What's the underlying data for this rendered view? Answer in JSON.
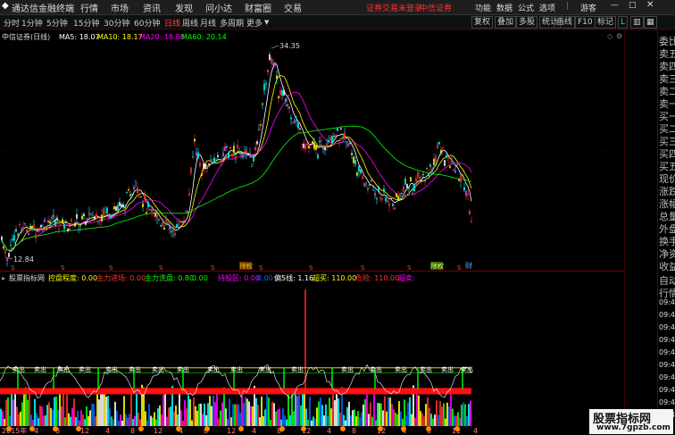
{
  "app": {
    "title": "通达信金融终端",
    "menu": [
      "行情",
      "市场",
      "资讯",
      "发现",
      "问小达",
      "财富圈",
      "交易"
    ],
    "notice": "证券交易未登录",
    "broker": "中信证券",
    "right_menu": [
      "功能",
      "数据",
      "公式",
      "选项"
    ],
    "user": "游客"
  },
  "toolbar": {
    "periods": [
      "分时",
      "1分钟",
      "5分钟",
      "15分钟",
      "30分钟",
      "60分钟",
      "日线",
      "周线",
      "月线",
      "多周期",
      "更多"
    ],
    "active_period": "日线",
    "right_buttons": [
      "复权",
      "叠加",
      "多股",
      "统计",
      "画线",
      "F10",
      "标记"
    ]
  },
  "main": {
    "stock_label": "中信证券(日线)",
    "ma": [
      {
        "label": "MA5: 18.07",
        "color": "#ffffff"
      },
      {
        "label": "MA10: 18.17",
        "color": "#ffff00"
      },
      {
        "label": "MA20: 18.80",
        "color": "#ff00ff"
      },
      {
        "label": "MA60: 20.14",
        "color": "#00ff00"
      }
    ],
    "high_label": "34.35",
    "low_label": "12.84",
    "y_ticks": [
      "34.00",
      "32.00",
      "30.00",
      "28.00",
      "26.00",
      "24.00",
      "22.00",
      "20.00",
      "18.00",
      "16.00",
      "14.00"
    ],
    "ylim": [
      13,
      35
    ],
    "events": [
      "除权",
      "除权",
      "财"
    ]
  },
  "indicator": {
    "name": "股票指标网",
    "items": [
      {
        "label": "控盘程度: 0.00",
        "color": "#ffff00"
      },
      {
        "label": "主力进场: 0.00",
        "color": "#ff3333"
      },
      {
        "label": "主力洗盘: 0.80",
        "color": "#00ff00"
      },
      {
        "label": "0.00",
        "color": "#00ff00"
      },
      {
        "label": "持股区: 0.00",
        "color": "#ff00ff"
      },
      {
        "label": "0.00",
        "color": "#0066ff"
      },
      {
        "label": "偏5线: 1.16",
        "color": "#ffffff"
      },
      {
        "label": "超买: 110.00",
        "color": "#ffff00"
      },
      {
        "label": "危险: 110.00",
        "color": "#ff3333"
      },
      {
        "label": "超卖: ",
        "color": "#ff00ff"
      }
    ],
    "y_ticks": [
      "250.00",
      "200.00",
      "150.00",
      "100.00",
      "50.00",
      "0.00"
    ],
    "ylim": [
      0,
      270
    ],
    "sell_label": "卖出"
  },
  "right_panel": {
    "labels": [
      "委比",
      "卖五",
      "卖四",
      "卖三",
      "卖二",
      "卖一",
      "买一",
      "买二",
      "买三",
      "买四",
      "买五",
      "现价",
      "涨跌",
      "涨幅",
      "总量",
      "外盘",
      "换手",
      "净资",
      "收益"
    ],
    "labels2": [
      "自动",
      "行情",
      "09:47",
      "09:47",
      "09:47",
      "09:47",
      "09:47",
      "09:47",
      "09:47",
      "09:47",
      "09:47",
      "09:47"
    ]
  },
  "x_axis": {
    "labels": [
      "2015年",
      "4",
      "8",
      "12",
      "4",
      "8",
      "12",
      "4",
      "8",
      "12",
      "4",
      "8",
      "12",
      "4",
      "8",
      "12",
      "4",
      "8",
      "12",
      "4"
    ]
  },
  "watermark": {
    "title": "股票指标网",
    "url": "www.7gpzb.com"
  },
  "chart_data": {
    "type": "candlestick",
    "ylim": [
      13,
      35
    ],
    "high": 34.35,
    "low": 12.84,
    "indicator_ylim": [
      0,
      270
    ],
    "indicator_lines": [
      110,
      100
    ]
  }
}
